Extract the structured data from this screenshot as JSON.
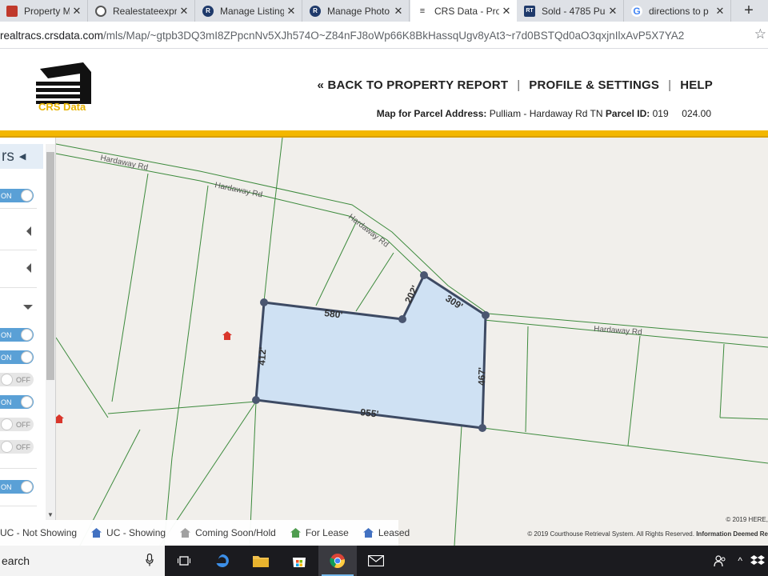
{
  "browser": {
    "tabs": [
      {
        "title": "Property Mana",
        "icon": "favicon-square-icon",
        "color": "#c0392b",
        "glyph": ""
      },
      {
        "title": "Realestateexpr",
        "icon": "globe-icon",
        "color": "#555555",
        "glyph": ""
      },
      {
        "title": "Manage Listing",
        "icon": "rt-favicon-icon",
        "color": "#1f3a6b",
        "glyph": "R"
      },
      {
        "title": "Manage Photo",
        "icon": "rt-favicon-icon",
        "color": "#1f3a6b",
        "glyph": "R"
      },
      {
        "title": "CRS Data - Pro",
        "icon": "crs-favicon-icon",
        "color": "#333333",
        "glyph": ""
      },
      {
        "title": "Sold - 4785 Pu",
        "icon": "rt-favicon-icon",
        "color": "#1f3a6b",
        "glyph": "RT"
      },
      {
        "title": "directions to p",
        "icon": "google-icon",
        "color": "#4285f4",
        "glyph": "G"
      }
    ],
    "active_tab": 4,
    "close_glyph": "✕",
    "new_tab_glyph": "+",
    "url_host": "realtracs.crsdata.com",
    "url_path": "/mls/Map/~gtpb3DQ3mI8ZPpcnNv5XJh574O~Z84nFJ8oWp66K8BkHassqUgv8yAt3~r7d0BSTQd0aO3qxjnIlxAvP5X7YA2"
  },
  "header": {
    "logo_text": "CRS Data",
    "nav": [
      "« BACK TO PROPERTY REPORT",
      "PROFILE & SETTINGS",
      "HELP"
    ],
    "nav_sep": "|",
    "parcel_label_1": "Map for Parcel Address:",
    "parcel_address": "Pulliam - Hardaway Rd TN",
    "parcel_label_2": "Parcel ID:",
    "parcel_id": "019     024.00",
    "accent_color": "#f3b700"
  },
  "panel": {
    "heading": "rs",
    "toggles": [
      "ON",
      "ON",
      "ON",
      "OFF",
      "ON",
      "OFF",
      "OFF",
      "ON"
    ]
  },
  "map": {
    "road_labels": [
      "Hardaway Rd",
      "Hardaway Rd",
      "Hardaway Rd",
      "Hardaway Rd"
    ],
    "dimensions": [
      "580'",
      "202'",
      "309'",
      "412'",
      "467'",
      "955'"
    ],
    "parcel_fill": "#cfe1f3",
    "parcel_stroke": "#3d4a63",
    "road_color": "#3c8a3c"
  },
  "legend": {
    "items": [
      {
        "label": "UC - Not Showing",
        "icon": "house-icon",
        "color": "#3b6cc0"
      },
      {
        "label": "UC - Showing",
        "icon": "house-icon",
        "color": "#3b6cc0"
      },
      {
        "label": "Coming Soon/Hold",
        "icon": "house-icon",
        "color": "#9e9e9e"
      },
      {
        "label": "For Lease",
        "icon": "house-icon",
        "color": "#4a9a4a"
      },
      {
        "label": "Leased",
        "icon": "house-icon",
        "color": "#3b6cc0"
      }
    ],
    "copyright_1": "© 2019 HERE,",
    "copyright_2": "© 2019 Courthouse Retrieval System. All Rights Reserved.",
    "copyright_3": "Information Deemed Re"
  },
  "taskbar": {
    "search_text": "earch"
  }
}
